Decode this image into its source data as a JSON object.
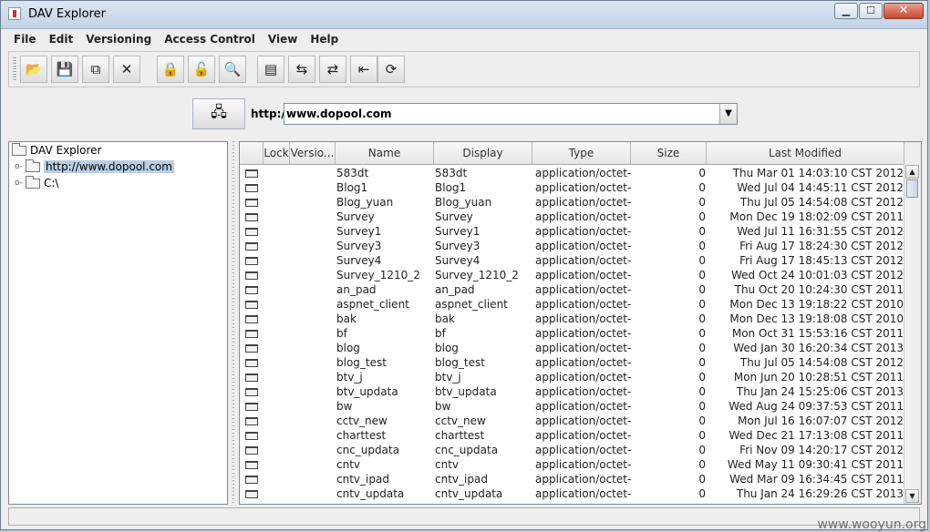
{
  "window": {
    "title": "DAV Explorer",
    "minimize": "▁",
    "maximize": "☐",
    "close": "✕"
  },
  "menubar": [
    "File",
    "Edit",
    "Versioning",
    "Access Control",
    "View",
    "Help"
  ],
  "toolbar": [
    {
      "icon": "folder-open-icon",
      "glyph": "📂"
    },
    {
      "icon": "save-icon",
      "glyph": "💾"
    },
    {
      "icon": "copy-icon",
      "glyph": "⧉"
    },
    {
      "icon": "delete-icon",
      "glyph": "✕"
    },
    {
      "icon": "lock-icon",
      "glyph": "🔒"
    },
    {
      "icon": "unlock-icon",
      "glyph": "🔓"
    },
    {
      "icon": "view-icon",
      "glyph": "🔍"
    },
    {
      "icon": "properties-icon",
      "glyph": "▤"
    },
    {
      "icon": "version-compare-icon",
      "glyph": "⇆"
    },
    {
      "icon": "checkout-icon",
      "glyph": "⇄"
    },
    {
      "icon": "checkin-icon",
      "glyph": "⇤"
    },
    {
      "icon": "refresh-icon",
      "glyph": "⟳"
    }
  ],
  "address": {
    "label": "http://",
    "value": "www.dopool.com",
    "connect_glyph": "🖧"
  },
  "tree": {
    "root": "DAV Explorer",
    "nodes": [
      "http://www.dopool.com",
      "C:\\"
    ]
  },
  "table": {
    "columns": [
      "Lock",
      "Versio...",
      "Name",
      "Display",
      "Type",
      "Size",
      "Last Modified"
    ],
    "rows": [
      {
        "name": "583dt",
        "display": "583dt",
        "type": "application/octet-...",
        "size": "0",
        "modified": "Thu Mar 01 14:03:10 CST 2012"
      },
      {
        "name": "Blog1",
        "display": "Blog1",
        "type": "application/octet-...",
        "size": "0",
        "modified": "Wed Jul 04 14:45:11 CST 2012"
      },
      {
        "name": "Blog_yuan",
        "display": "Blog_yuan",
        "type": "application/octet-...",
        "size": "0",
        "modified": "Thu Jul 05 14:54:08 CST 2012"
      },
      {
        "name": "Survey",
        "display": "Survey",
        "type": "application/octet-...",
        "size": "0",
        "modified": "Mon Dec 19 18:02:09 CST 2011"
      },
      {
        "name": "Survey1",
        "display": "Survey1",
        "type": "application/octet-...",
        "size": "0",
        "modified": "Wed Jul 11 16:31:55 CST 2012"
      },
      {
        "name": "Survey3",
        "display": "Survey3",
        "type": "application/octet-...",
        "size": "0",
        "modified": "Fri Aug 17 18:24:30 CST 2012"
      },
      {
        "name": "Survey4",
        "display": "Survey4",
        "type": "application/octet-...",
        "size": "0",
        "modified": "Fri Aug 17 18:45:13 CST 2012"
      },
      {
        "name": "Survey_1210_2",
        "display": "Survey_1210_2",
        "type": "application/octet-...",
        "size": "0",
        "modified": "Wed Oct 24 10:01:03 CST 2012"
      },
      {
        "name": "an_pad",
        "display": "an_pad",
        "type": "application/octet-...",
        "size": "0",
        "modified": "Thu Oct 20 10:24:30 CST 2011"
      },
      {
        "name": "aspnet_client",
        "display": "aspnet_client",
        "type": "application/octet-...",
        "size": "0",
        "modified": "Mon Dec 13 19:18:22 CST 2010"
      },
      {
        "name": "bak",
        "display": "bak",
        "type": "application/octet-...",
        "size": "0",
        "modified": "Mon Dec 13 19:18:08 CST 2010"
      },
      {
        "name": "bf",
        "display": "bf",
        "type": "application/octet-...",
        "size": "0",
        "modified": "Mon Oct 31 15:53:16 CST 2011"
      },
      {
        "name": "blog",
        "display": "blog",
        "type": "application/octet-...",
        "size": "0",
        "modified": "Wed Jan 30 16:20:34 CST 2013"
      },
      {
        "name": "blog_test",
        "display": "blog_test",
        "type": "application/octet-...",
        "size": "0",
        "modified": "Thu Jul 05 14:54:08 CST 2012"
      },
      {
        "name": "btv_j",
        "display": "btv_j",
        "type": "application/octet-...",
        "size": "0",
        "modified": "Mon Jun 20 10:28:51 CST 2011"
      },
      {
        "name": "btv_updata",
        "display": "btv_updata",
        "type": "application/octet-...",
        "size": "0",
        "modified": "Thu Jan 24 15:25:06 CST 2013"
      },
      {
        "name": "bw",
        "display": "bw",
        "type": "application/octet-...",
        "size": "0",
        "modified": "Wed Aug 24 09:37:53 CST 2011"
      },
      {
        "name": "cctv_new",
        "display": "cctv_new",
        "type": "application/octet-...",
        "size": "0",
        "modified": "Mon Jul 16 16:07:07 CST 2012"
      },
      {
        "name": "charttest",
        "display": "charttest",
        "type": "application/octet-...",
        "size": "0",
        "modified": "Wed Dec 21 17:13:08 CST 2011"
      },
      {
        "name": "cnc_updata",
        "display": "cnc_updata",
        "type": "application/octet-...",
        "size": "0",
        "modified": "Fri Nov 09 14:20:17 CST 2012"
      },
      {
        "name": "cntv",
        "display": "cntv",
        "type": "application/octet-...",
        "size": "0",
        "modified": "Wed May 11 09:30:41 CST 2011"
      },
      {
        "name": "cntv_ipad",
        "display": "cntv_ipad",
        "type": "application/octet-...",
        "size": "0",
        "modified": "Wed Mar 09 16:34:45 CST 2011"
      },
      {
        "name": "cntv_updata",
        "display": "cntv_updata",
        "type": "application/octet-...",
        "size": "0",
        "modified": "Thu Jan 24 16:29:26 CST 2013"
      }
    ]
  },
  "scroll": {
    "up": "▲",
    "down": "▼"
  },
  "watermark": "www.wooyun.org"
}
